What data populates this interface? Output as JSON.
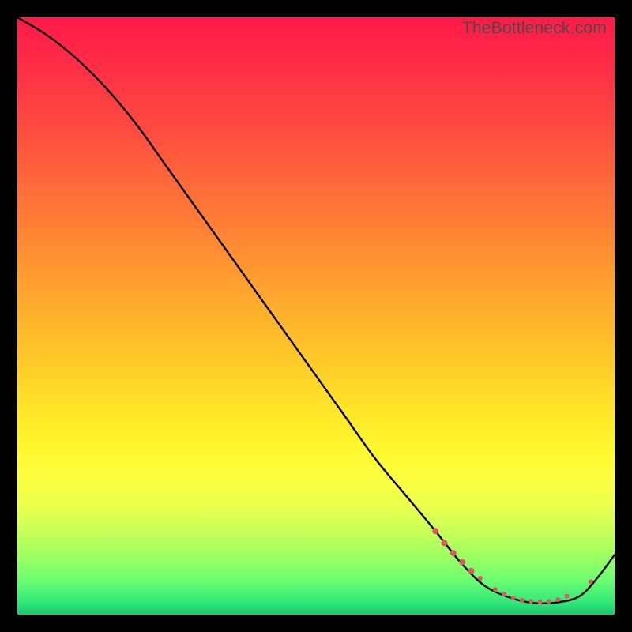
{
  "watermark": "TheBottleneck.com",
  "chart_data": {
    "type": "line",
    "title": "",
    "xlabel": "",
    "ylabel": "",
    "xlim": [
      0,
      100
    ],
    "ylim": [
      0,
      100
    ],
    "series": [
      {
        "name": "curve",
        "x": [
          0,
          5,
          10,
          15,
          20,
          25,
          30,
          35,
          40,
          45,
          50,
          55,
          60,
          65,
          70,
          74,
          78,
          82,
          86,
          90,
          94,
          97,
          100
        ],
        "y": [
          100,
          97,
          93,
          88,
          82,
          75,
          68,
          61,
          54,
          47,
          40,
          33,
          26,
          20,
          14,
          9,
          5,
          3,
          2,
          2,
          3,
          6,
          10
        ]
      }
    ],
    "markers": {
      "name": "highlight-dots",
      "color": "#d95a5f",
      "points": [
        {
          "x": 70.0,
          "y": 14.0,
          "r": 4
        },
        {
          "x": 71.5,
          "y": 12.0,
          "r": 4
        },
        {
          "x": 73.0,
          "y": 10.3,
          "r": 4
        },
        {
          "x": 74.5,
          "y": 8.8,
          "r": 4
        },
        {
          "x": 76.0,
          "y": 7.3,
          "r": 4
        },
        {
          "x": 77.5,
          "y": 6.1,
          "r": 3
        },
        {
          "x": 80.0,
          "y": 4.2,
          "r": 3
        },
        {
          "x": 81.5,
          "y": 3.4,
          "r": 3
        },
        {
          "x": 83.0,
          "y": 2.8,
          "r": 3
        },
        {
          "x": 84.5,
          "y": 2.4,
          "r": 3
        },
        {
          "x": 86.0,
          "y": 2.2,
          "r": 3
        },
        {
          "x": 87.5,
          "y": 2.1,
          "r": 3
        },
        {
          "x": 89.0,
          "y": 2.2,
          "r": 3
        },
        {
          "x": 90.5,
          "y": 2.5,
          "r": 3
        },
        {
          "x": 92.0,
          "y": 3.1,
          "r": 3
        },
        {
          "x": 96.0,
          "y": 5.5,
          "r": 3
        }
      ]
    }
  }
}
